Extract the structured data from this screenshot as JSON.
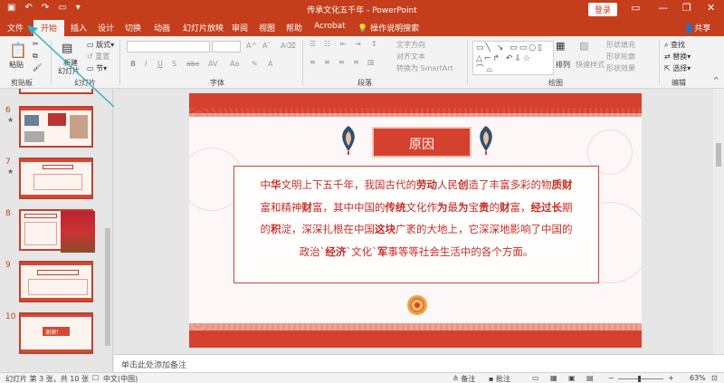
{
  "titlebar": {
    "title": "传承文化五千年 - PowerPoint",
    "login_label": "登录",
    "minimize_icon": "minimize-icon",
    "restore_icon": "restore-icon",
    "close_icon": "close-icon"
  },
  "tabs": [
    "文件",
    "开始",
    "插入",
    "设计",
    "切换",
    "动画",
    "幻灯片放映",
    "审阅",
    "视图",
    "帮助",
    "Acrobat"
  ],
  "active_tab": "开始",
  "tell_me": "操作说明搜索",
  "share_label": "共享",
  "ribbon": {
    "clipboard": {
      "paste": "粘贴",
      "label": "剪贴板"
    },
    "slides": {
      "new_slide": "新建",
      "new_slide2": "幻灯片",
      "layout": "版式",
      "reset": "重置",
      "section": "节",
      "label": "幻灯片"
    },
    "font": {
      "bold": "B",
      "italic": "I",
      "underline": "U",
      "shadow": "S",
      "strike": "abc",
      "spacing": "AV",
      "case": "Aa",
      "color": "A",
      "label": "字体"
    },
    "paragraph": {
      "text_direction": "文字方向",
      "align_text": "对齐文本",
      "smartart": "转换为 SmartArt",
      "label": "段落"
    },
    "drawing": {
      "arrange": "排列",
      "quick_styles": "快速样式",
      "fill": "形状填充",
      "outline": "形状轮廓",
      "effects": "形状效果",
      "label": "绘图"
    },
    "editing": {
      "find": "查找",
      "replace": "替换",
      "select": "选择",
      "label": "编辑"
    }
  },
  "thumbnails": [
    {
      "num": "6",
      "star": "★",
      "label": ""
    },
    {
      "num": "7",
      "star": "★",
      "label": ""
    },
    {
      "num": "8",
      "star": "",
      "label": ""
    },
    {
      "num": "9",
      "star": "",
      "label": ""
    },
    {
      "num": "10",
      "star": "",
      "label": "谢谢！"
    }
  ],
  "slide": {
    "title": "原因",
    "lines": [
      [
        [
          "中",
          0
        ],
        [
          "华",
          1
        ],
        [
          "文明上下五千年，我国古代的",
          0
        ],
        [
          "劳动",
          1
        ],
        [
          "人民",
          0
        ],
        [
          "创",
          1
        ],
        [
          "造了丰富多彩的物",
          0
        ],
        [
          "质财",
          1
        ]
      ],
      [
        [
          "富和精神",
          0
        ],
        [
          "财",
          1
        ],
        [
          "富，其中中国的",
          0
        ],
        [
          "传统",
          1
        ],
        [
          "文化作",
          0
        ],
        [
          "为",
          1
        ],
        [
          "最",
          0
        ],
        [
          "为",
          1
        ],
        [
          "宝",
          0
        ],
        [
          "贵",
          1
        ],
        [
          "的",
          0
        ],
        [
          "财",
          1
        ],
        [
          "富，",
          0
        ],
        [
          "经过长",
          1
        ],
        [
          "期",
          0
        ]
      ],
      [
        [
          "的",
          0
        ],
        [
          "积",
          1
        ],
        [
          "淀，深深扎根在中国",
          0
        ],
        [
          "这块",
          1
        ],
        [
          "广袤的大地上，它深深地影响了中国的",
          0
        ]
      ],
      [
        [
          "政治`",
          0
        ],
        [
          "经济",
          1
        ],
        [
          "`文化`",
          0
        ],
        [
          "军",
          1
        ],
        [
          "事等等社会生活中的各个方面。",
          0
        ]
      ]
    ]
  },
  "notes_placeholder": "单击此处添加备注",
  "status": {
    "slide_info": "幻灯片 第 3 张，共 10 张",
    "language": "中文(中国)",
    "notes": "备注",
    "comments": "批注",
    "zoom": "63%"
  },
  "colors": {
    "accent": "#c43e1c",
    "slide_red": "#d6402f",
    "text_red": "#c62e28"
  }
}
